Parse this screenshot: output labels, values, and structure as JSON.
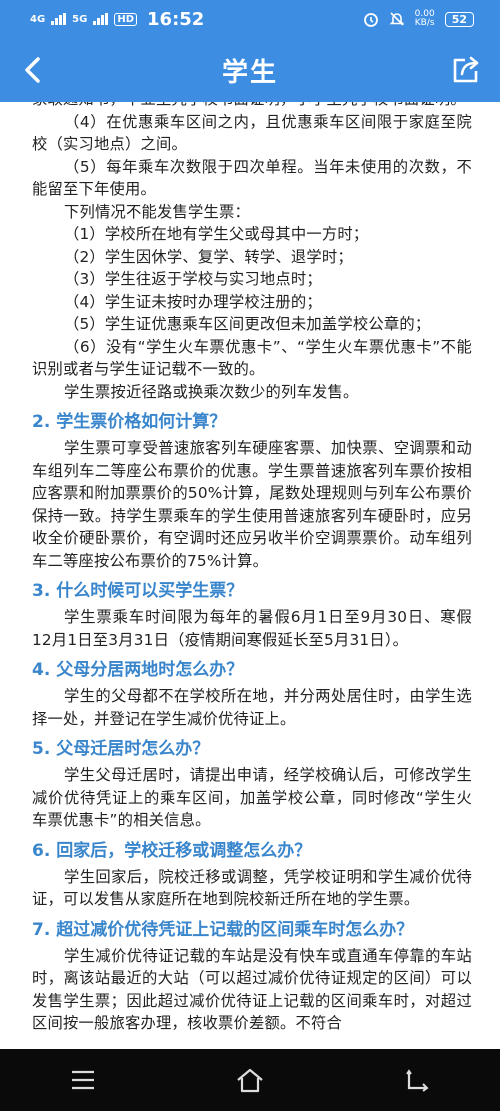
{
  "status_bar": {
    "signal_1": "4G",
    "signal_2": "5G",
    "hd": "HD",
    "time": "16:52",
    "net_speed_value": "0.00",
    "net_speed_unit": "KB/s",
    "battery": "52"
  },
  "header": {
    "title": "学生",
    "accent_color": "#3d8ee3"
  },
  "content": {
    "paragraphs": [
      "家取通知书，毕业生凭学校书面证明，小学生凭学校书面证明。",
      "（4）在优惠乘车区间之内，且优惠乘车区间限于家庭至院校（实习地点）之间。",
      "（5）每年乘车次数限于四次单程。当年未使用的次数，不能留至下年使用。",
      "下列情况不能发售学生票：",
      "（1）学校所在地有学生父或母其中一方时；",
      "（2）学生因休学、复学、转学、退学时；",
      "（3）学生往返于学校与实习地点时；",
      "（4）学生证未按时办理学校注册的；",
      "（5）学生证优惠乘车区间更改但未加盖学校公章的；",
      "（6）没有“学生火车票优惠卡”、“学生火车票优惠卡”不能识别或者与学生证记载不一致的。",
      "学生票按近径路或换乘次数少的列车发售。"
    ],
    "sections": [
      {
        "heading": "2. 学生票价格如何计算？",
        "body": "学生票可享受普速旅客列车硬座客票、加快票、空调票和动车组列车二等座公布票价的优惠。学生票普速旅客列车票价按相应客票和附加票票价的50%计算，尾数处理规则与列车公布票价保持一致。持学生票乘车的学生使用普速旅客列车硬卧时，应另收全价硬卧票价，有空调时还应另收半价空调票票价。动车组列车二等座按公布票价的75%计算。"
      },
      {
        "heading": "3. 什么时候可以买学生票？",
        "body": "学生票乘车时间限为每年的暑假6月1日至9月30日、寒假12月1日至3月31日（疫情期间寒假延长至5月31日）。"
      },
      {
        "heading": "4. 父母分居两地时怎么办？",
        "body": "学生的父母都不在学校所在地，并分两处居住时，由学生选择一处，并登记在学生减价优待证上。"
      },
      {
        "heading": "5. 父母迁居时怎么办？",
        "body": "学生父母迁居时，请提出申请，经学校确认后，可修改学生减价优待凭证上的乘车区间，加盖学校公章，同时修改“学生火车票优惠卡”的相关信息。"
      },
      {
        "heading": "6. 回家后，学校迁移或调整怎么办？",
        "body": "学生回家后，院校迁移或调整，凭学校证明和学生减价优待证，可以发售从家庭所在地到院校新迁所在地的学生票。"
      },
      {
        "heading": "7. 超过减价优待凭证上记载的区间乘车时怎么办？",
        "body": "学生减价优待证记载的车站是没有快车或直通车停靠的车站时，离该站最近的大站（可以超过减价优待证规定的区间）可以发售学生票；因此超过减价优待证上记载的区间乘车时，对超过区间按一般旅客办理，核收票价差额。不符合"
      }
    ]
  },
  "icons": {
    "back": "chevron-left-icon",
    "share": "share-icon",
    "menu": "menu-icon",
    "home": "home-icon",
    "return": "return-icon"
  }
}
